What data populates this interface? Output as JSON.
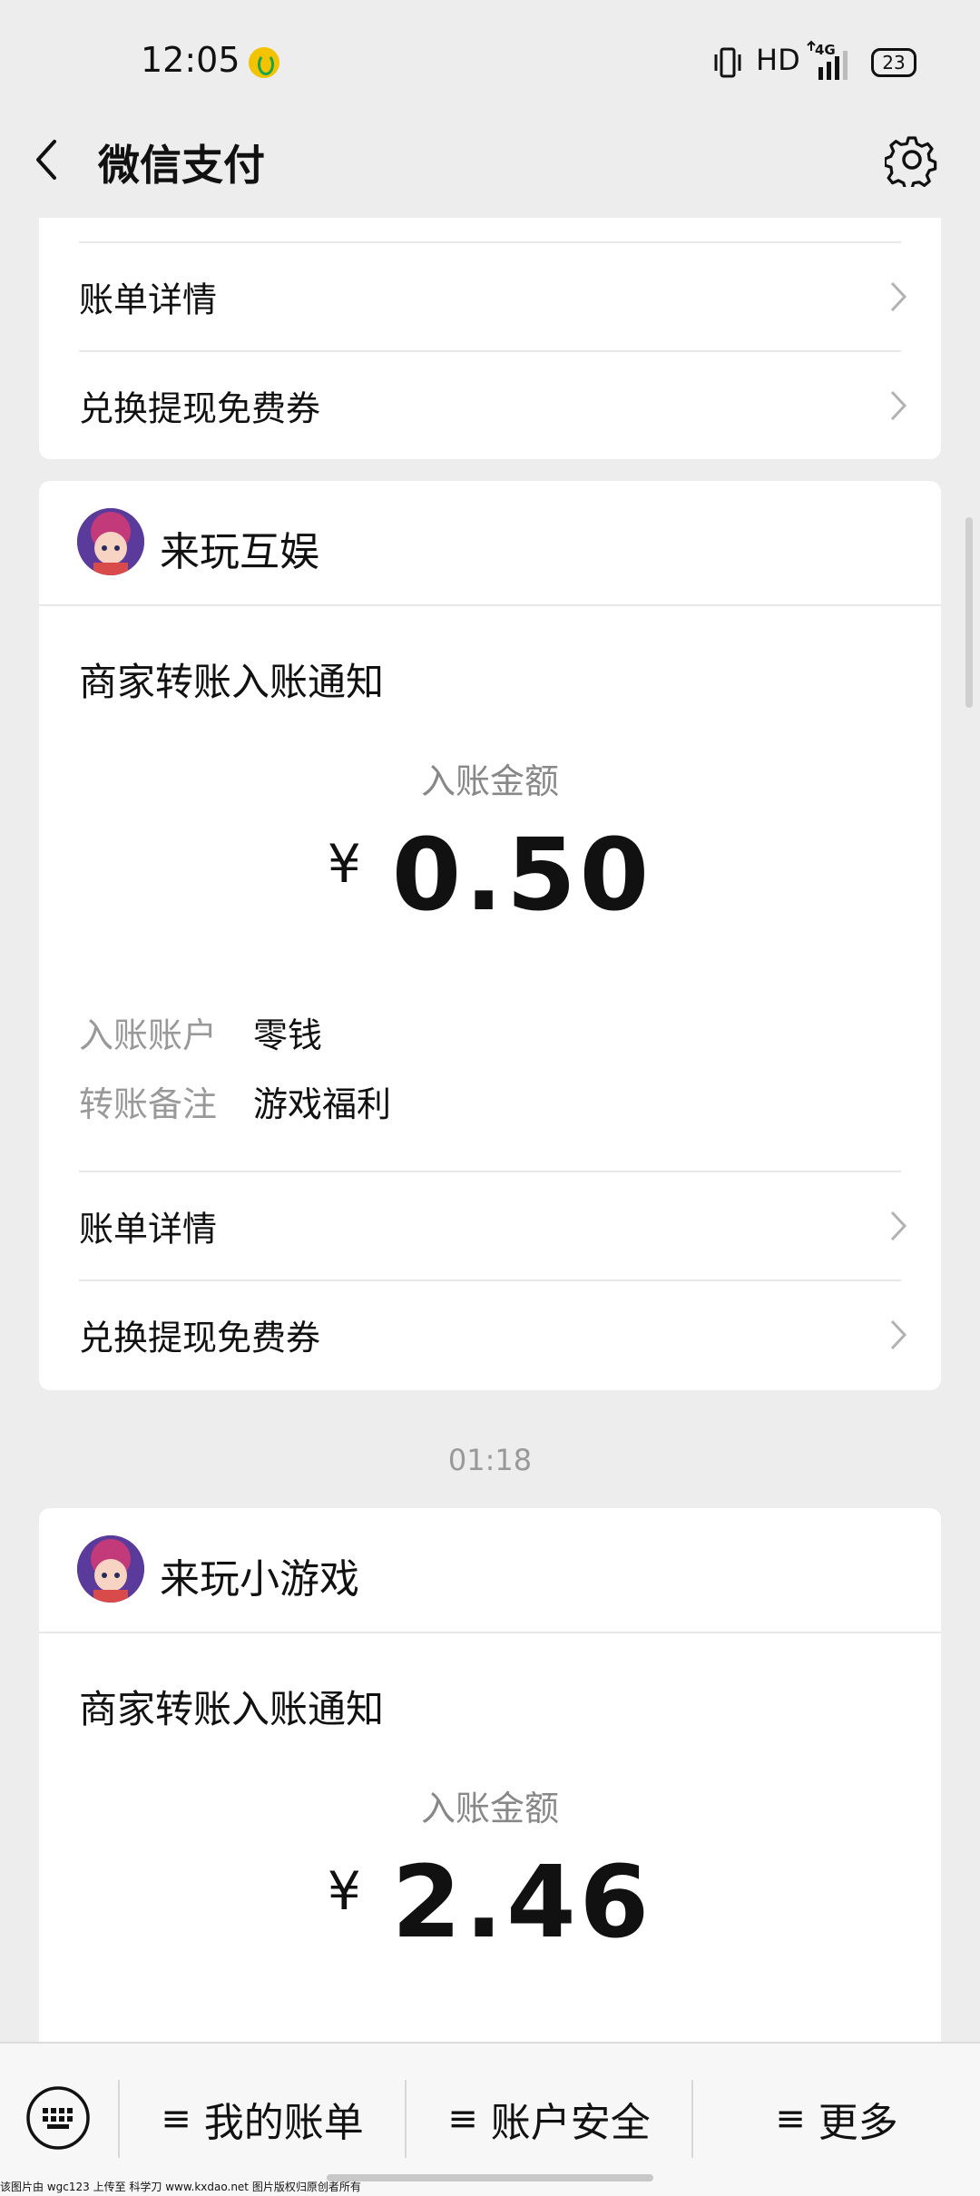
{
  "status_bar": {
    "time": "12:05",
    "hd": "HD",
    "network": "4G",
    "battery": "23"
  },
  "nav": {
    "title": "微信支付"
  },
  "top_card": {
    "rows": [
      {
        "label": "账单详情"
      },
      {
        "label": "兑换提现免费券"
      }
    ]
  },
  "messages": [
    {
      "merchant": "来玩互娱",
      "notice_title": "商家转账入账通知",
      "amount_label": "入账金额",
      "currency": "¥",
      "amount": "0.50",
      "details": [
        {
          "key": "入账账户",
          "value": "零钱"
        },
        {
          "key": "转账备注",
          "value": "游戏福利"
        }
      ],
      "rows": [
        {
          "label": "账单详情"
        },
        {
          "label": "兑换提现免费券"
        }
      ]
    },
    {
      "time": "01:18",
      "merchant": "来玩小游戏",
      "notice_title": "商家转账入账通知",
      "amount_label": "入账金额",
      "currency": "¥",
      "amount": "2.46"
    }
  ],
  "bottom_menu": {
    "items": [
      {
        "label": "我的账单"
      },
      {
        "label": "账户安全"
      },
      {
        "label": "更多"
      }
    ],
    "hamburger": "≡"
  },
  "footer": {
    "text": "该图片由 wgc123 上传至 科学刀 www.kxdao.net 图片版权归原创者所有"
  },
  "colors": {
    "background": "#ededed",
    "card": "#ffffff",
    "muted": "#888888"
  }
}
